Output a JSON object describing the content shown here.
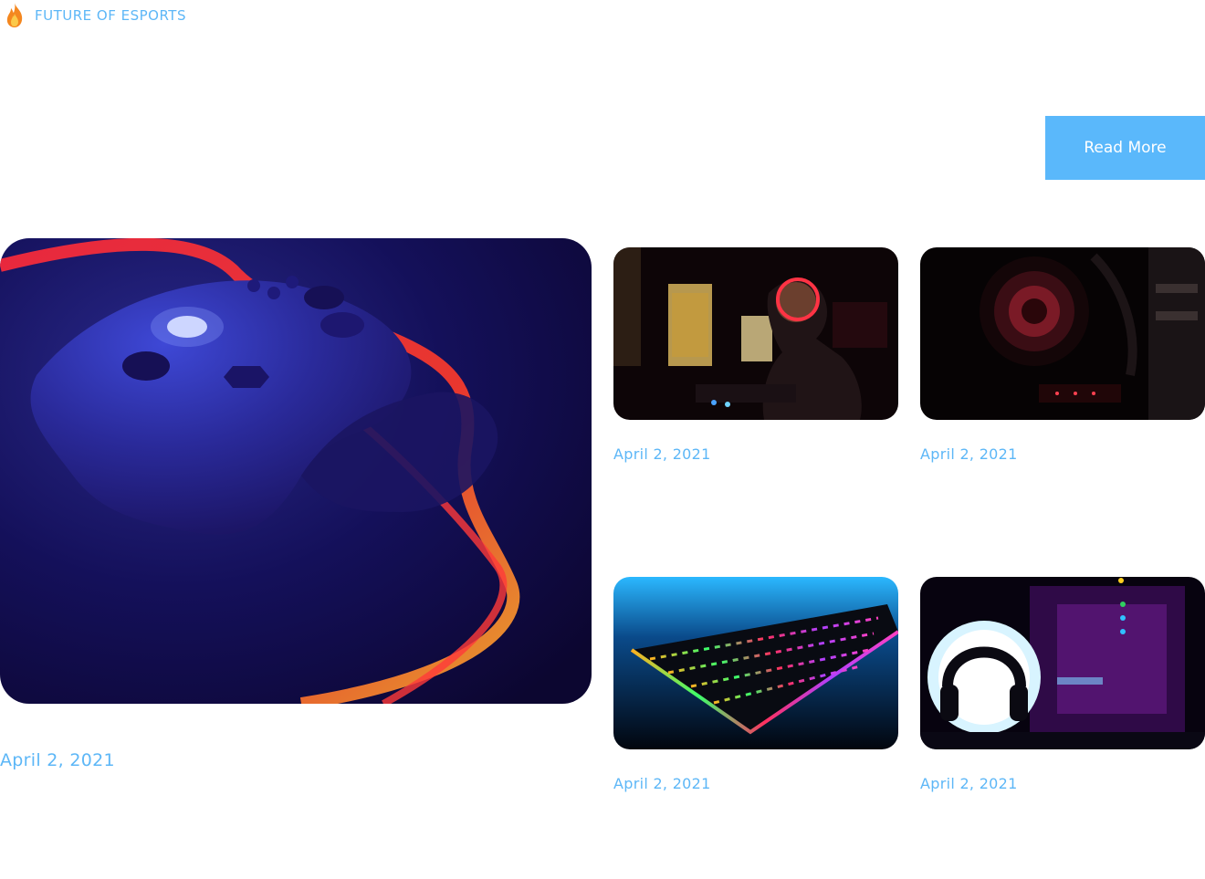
{
  "header": {
    "kicker_icon": "fire-icon",
    "kicker_text": "FUTURE OF ESPORTS",
    "read_more_label": "Read More"
  },
  "colors": {
    "accent": "#5db7f7",
    "button_bg": "#5ab8fb",
    "button_text": "#ffffff"
  },
  "posts": {
    "featured": {
      "date": "April 2, 2021",
      "image": "gamepad-controller-photo"
    },
    "items": [
      {
        "date": "April 2, 2021",
        "image": "gamer-with-headset-photo"
      },
      {
        "date": "April 2, 2021",
        "image": "pc-case-fan-photo"
      },
      {
        "date": "April 2, 2021",
        "image": "rgb-keyboard-photo"
      },
      {
        "date": "April 2, 2021",
        "image": "headphones-stand-photo"
      }
    ]
  }
}
